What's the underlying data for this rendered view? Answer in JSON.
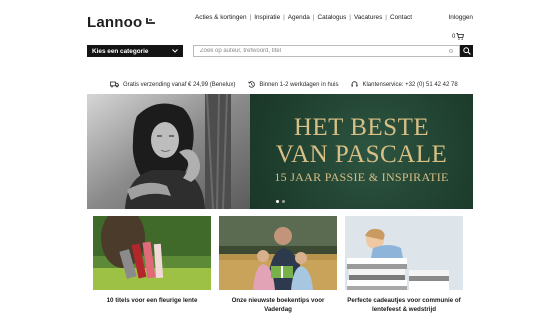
{
  "brand": {
    "logo": "Lannoo"
  },
  "nav": {
    "items": [
      {
        "label": "Acties & kortingen"
      },
      {
        "label": "Inspiratie"
      },
      {
        "label": "Agenda"
      },
      {
        "label": "Catalogus"
      },
      {
        "label": "Vacatures"
      },
      {
        "label": "Contact"
      }
    ],
    "login": "Inloggen"
  },
  "cart": {
    "count": "0"
  },
  "search": {
    "category_label": "Kies een categorie",
    "placeholder": "Zoek op auteur, trefwoord, titel"
  },
  "usps": [
    {
      "text": "Gratis verzending vanaf € 24,99 (Benelux)"
    },
    {
      "text": "Binnen 1-2 werkdagen in huis"
    },
    {
      "text": "Klantenservice: +32 (0) 51 42 42 78"
    }
  ],
  "hero": {
    "title_line1": "HET BESTE",
    "title_line2": "VAN PASCALE",
    "subtitle": "15 JAAR PASSIE & INSPIRATIE",
    "slide_count": 2,
    "active_slide": 1
  },
  "cards": [
    {
      "title": "10 titels voor een fleurige lente"
    },
    {
      "title": "Onze nieuwste boekentips voor Vaderdag"
    },
    {
      "title": "Perfecte cadeautjes voor communie of lentefeest & wedstrijd"
    }
  ],
  "colors": {
    "hero_green": "#234432",
    "hero_gold": "#d8bf86",
    "dark": "#141414"
  }
}
